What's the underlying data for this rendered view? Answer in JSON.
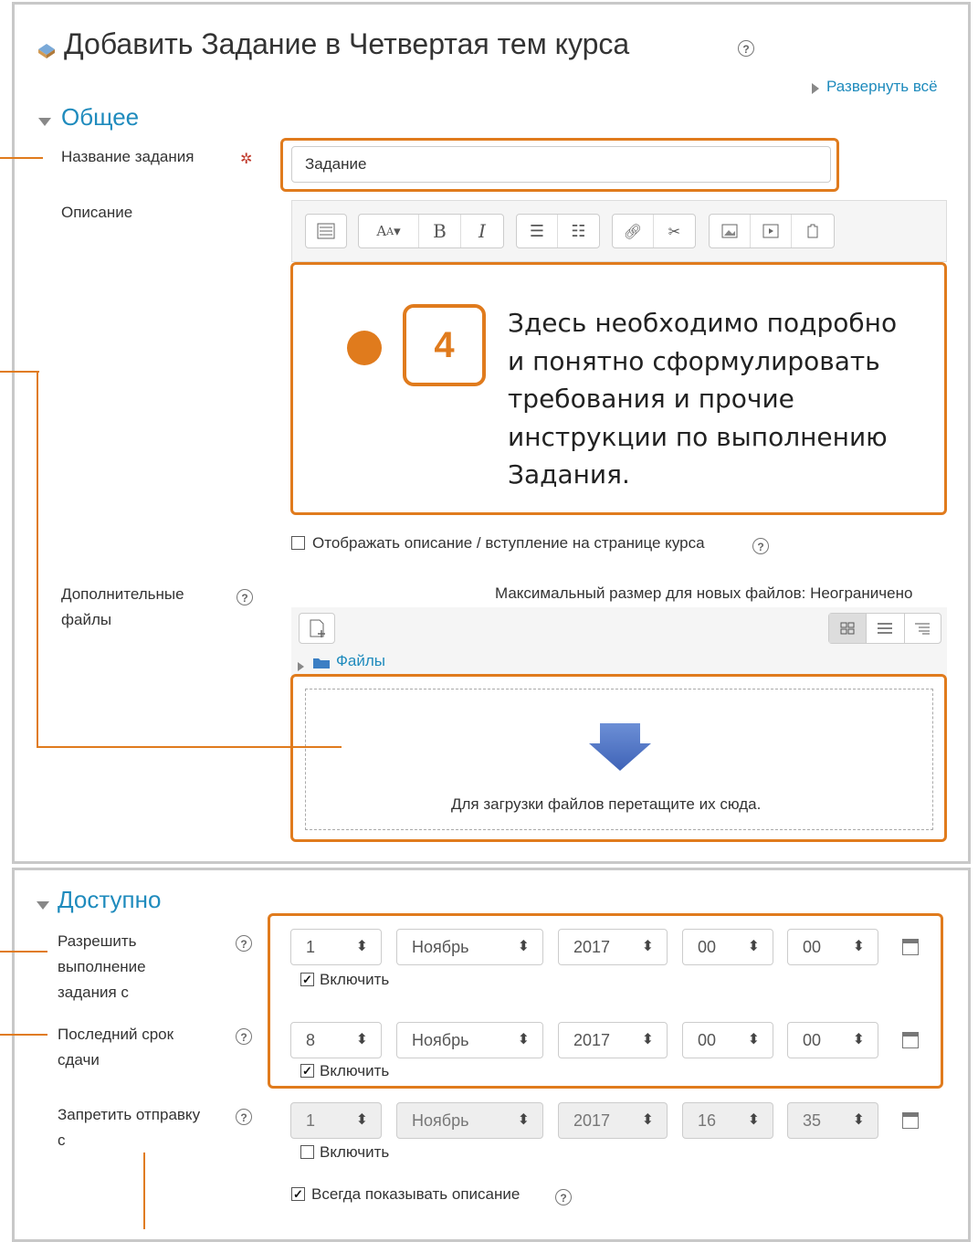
{
  "page": {
    "title": "Добавить Задание в Четвертая тем курса",
    "expand_all": "Развернуть всё"
  },
  "general": {
    "section_title": "Общее",
    "name_label": "Название задания",
    "name_value": "Задание",
    "description_label": "Описание",
    "annotation_number": "4",
    "annotation_text_lines": [
      "Здесь необходимо подробно",
      "и понятно сформулировать",
      "требования и прочие",
      "инструкции по выполнению",
      "Задания."
    ],
    "show_description_label": "Отображать описание / вступление на странице курса",
    "additional_files_label_1": "Дополнительные",
    "additional_files_label_2": "файлы",
    "max_size_text": "Максимальный размер для новых файлов: Неограничено",
    "folder_label": "Файлы",
    "dropzone_text": "Для загрузки файлов перетащите их сюда."
  },
  "availability": {
    "section_title": "Доступно",
    "rows": [
      {
        "label_lines": [
          "Разрешить",
          "выполнение",
          "задания с"
        ],
        "day": "1",
        "month": "Ноябрь",
        "year": "2017",
        "hour": "00",
        "minute": "00",
        "enable_label": "Включить",
        "enabled": true
      },
      {
        "label_lines": [
          "Последний срок",
          "сдачи"
        ],
        "day": "8",
        "month": "Ноябрь",
        "year": "2017",
        "hour": "00",
        "minute": "00",
        "enable_label": "Включить",
        "enabled": true
      },
      {
        "label_lines": [
          "Запретить отправку",
          "с"
        ],
        "day": "1",
        "month": "Ноябрь",
        "year": "2017",
        "hour": "16",
        "minute": "35",
        "enable_label": "Включить",
        "enabled": false
      }
    ],
    "always_show_description_label": "Всегда показывать описание"
  },
  "colors": {
    "accent_orange": "#e07b1d",
    "link_blue": "#1f8bbd",
    "panel_border": "#c8c8c8"
  },
  "icons": [
    "page-icon",
    "help-icon",
    "triangle-right-icon",
    "triangle-down-icon",
    "required-icon",
    "calendar-icon",
    "add-file-icon",
    "folder-icon",
    "download-arrow-icon",
    "grid-view-icon",
    "list-view-icon",
    "tree-view-icon"
  ]
}
